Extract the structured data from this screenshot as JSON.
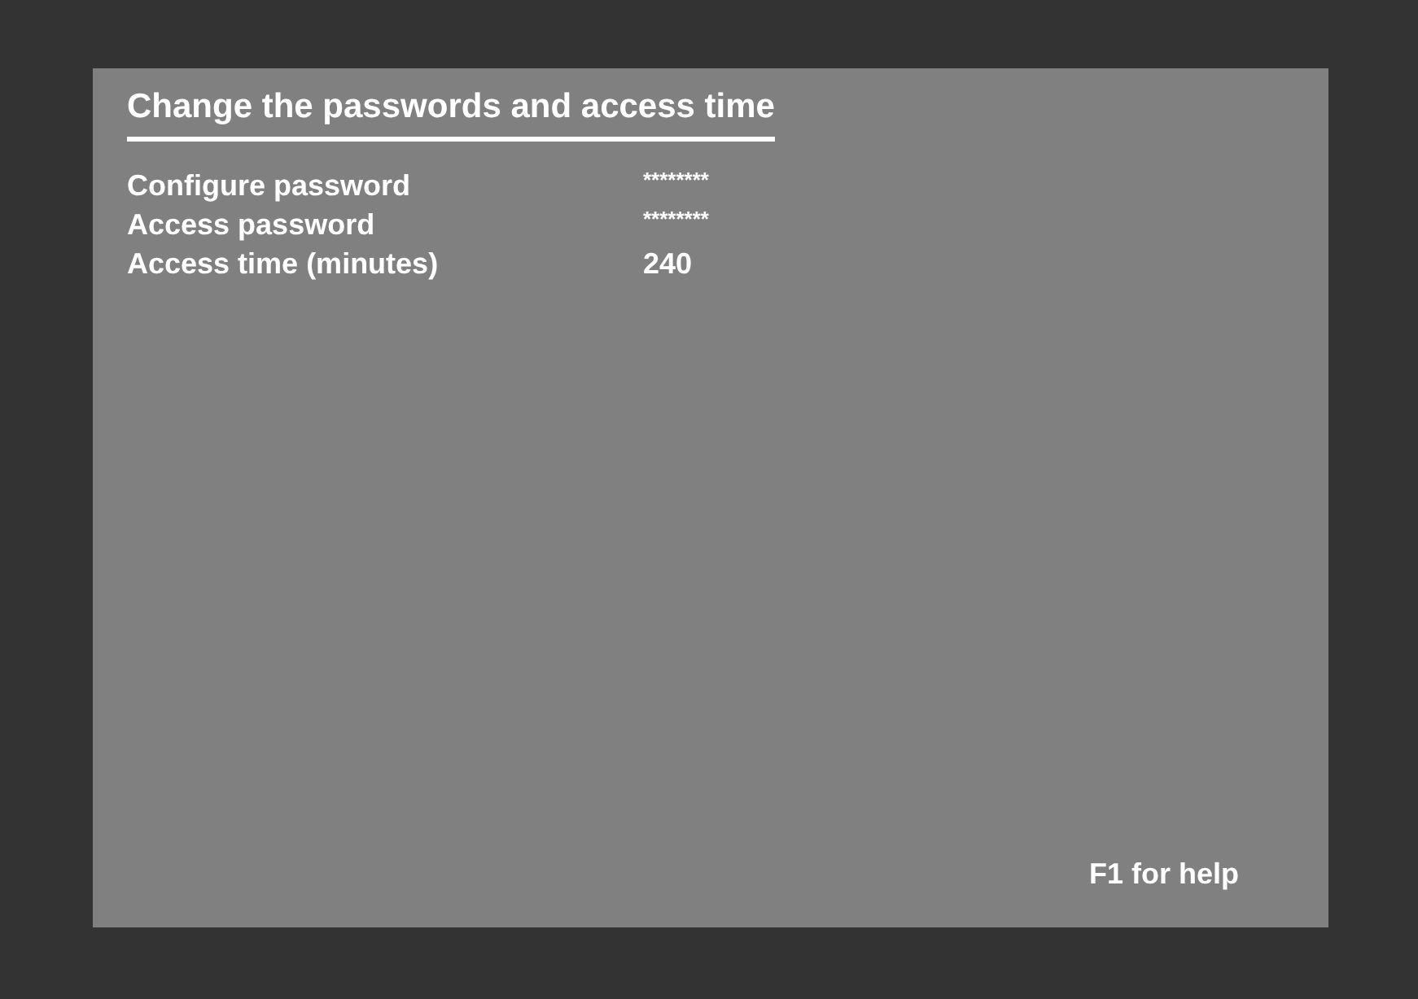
{
  "title": "Change the passwords and access time",
  "fields": [
    {
      "label": "Configure password",
      "value": "********",
      "kind": "masked"
    },
    {
      "label": "Access password",
      "value": "********",
      "kind": "masked"
    },
    {
      "label": "Access time (minutes)",
      "value": "240",
      "kind": "plain"
    }
  ],
  "help": "F1 for help"
}
